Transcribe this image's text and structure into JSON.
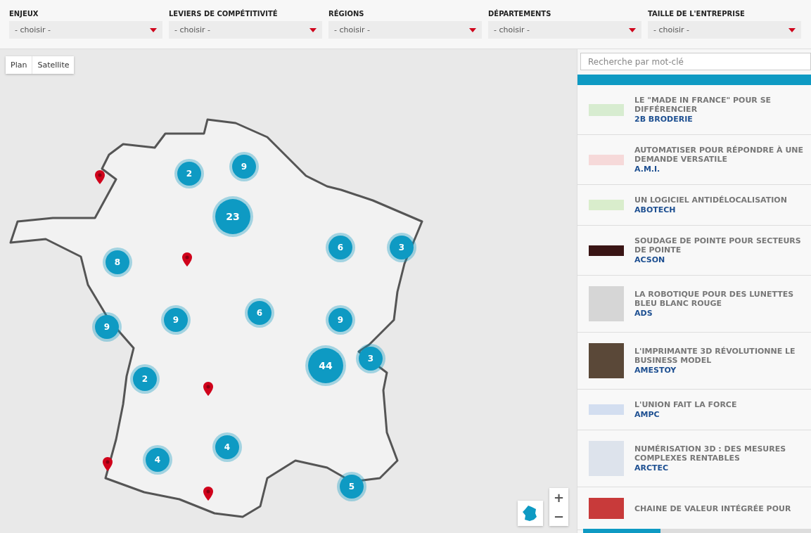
{
  "filters": [
    {
      "label": "ENJEUX",
      "value": "- choisir -"
    },
    {
      "label": "LEVIERS DE COMPÉTITIVITÉ",
      "value": "- choisir -"
    },
    {
      "label": "RÉGIONS",
      "value": "- choisir -"
    },
    {
      "label": "DÉPARTEMENTS",
      "value": "- choisir -"
    },
    {
      "label": "TAILLE DE L'ENTREPRISE",
      "value": "- choisir -"
    }
  ],
  "map": {
    "map_types": [
      "Plan",
      "Satellite"
    ],
    "clusters": [
      "2",
      "9",
      "23",
      "6",
      "3",
      "8",
      "9",
      "9",
      "6",
      "9",
      "44",
      "3",
      "2",
      "4",
      "4",
      "5"
    ],
    "zoom_in": "+",
    "zoom_out": "−"
  },
  "search": {
    "placeholder": "Recherche par mot-clé"
  },
  "stories": [
    {
      "title": "LE \"MADE IN FRANCE\" POUR SE DIFFÉRENCIER",
      "company": "2B BRODERIE"
    },
    {
      "title": "AUTOMATISER POUR RÉPONDRE À UNE DEMANDE VERSATILE",
      "company": "A.M.I."
    },
    {
      "title": "UN LOGICIEL ANTIDÉLOCALISATION",
      "company": "ABOTECH"
    },
    {
      "title": "SOUDAGE DE POINTE POUR SECTEURS DE POINTE",
      "company": "ACSON"
    },
    {
      "title": "LA ROBOTIQUE POUR DES LUNETTES BLEU BLANC ROUGE",
      "company": "ADS"
    },
    {
      "title": "L'IMPRIMANTE 3D RÉVOLUTIONNE LE BUSINESS MODEL",
      "company": "AMESTOY"
    },
    {
      "title": "L'UNION FAIT LA FORCE",
      "company": "AMPC"
    },
    {
      "title": "NUMÉRISATION 3D : DES MESURES COMPLEXES RENTABLES",
      "company": "ARCTEC"
    },
    {
      "title": "CHAINE DE VALEUR INTÉGRÉE POUR"
    }
  ]
}
